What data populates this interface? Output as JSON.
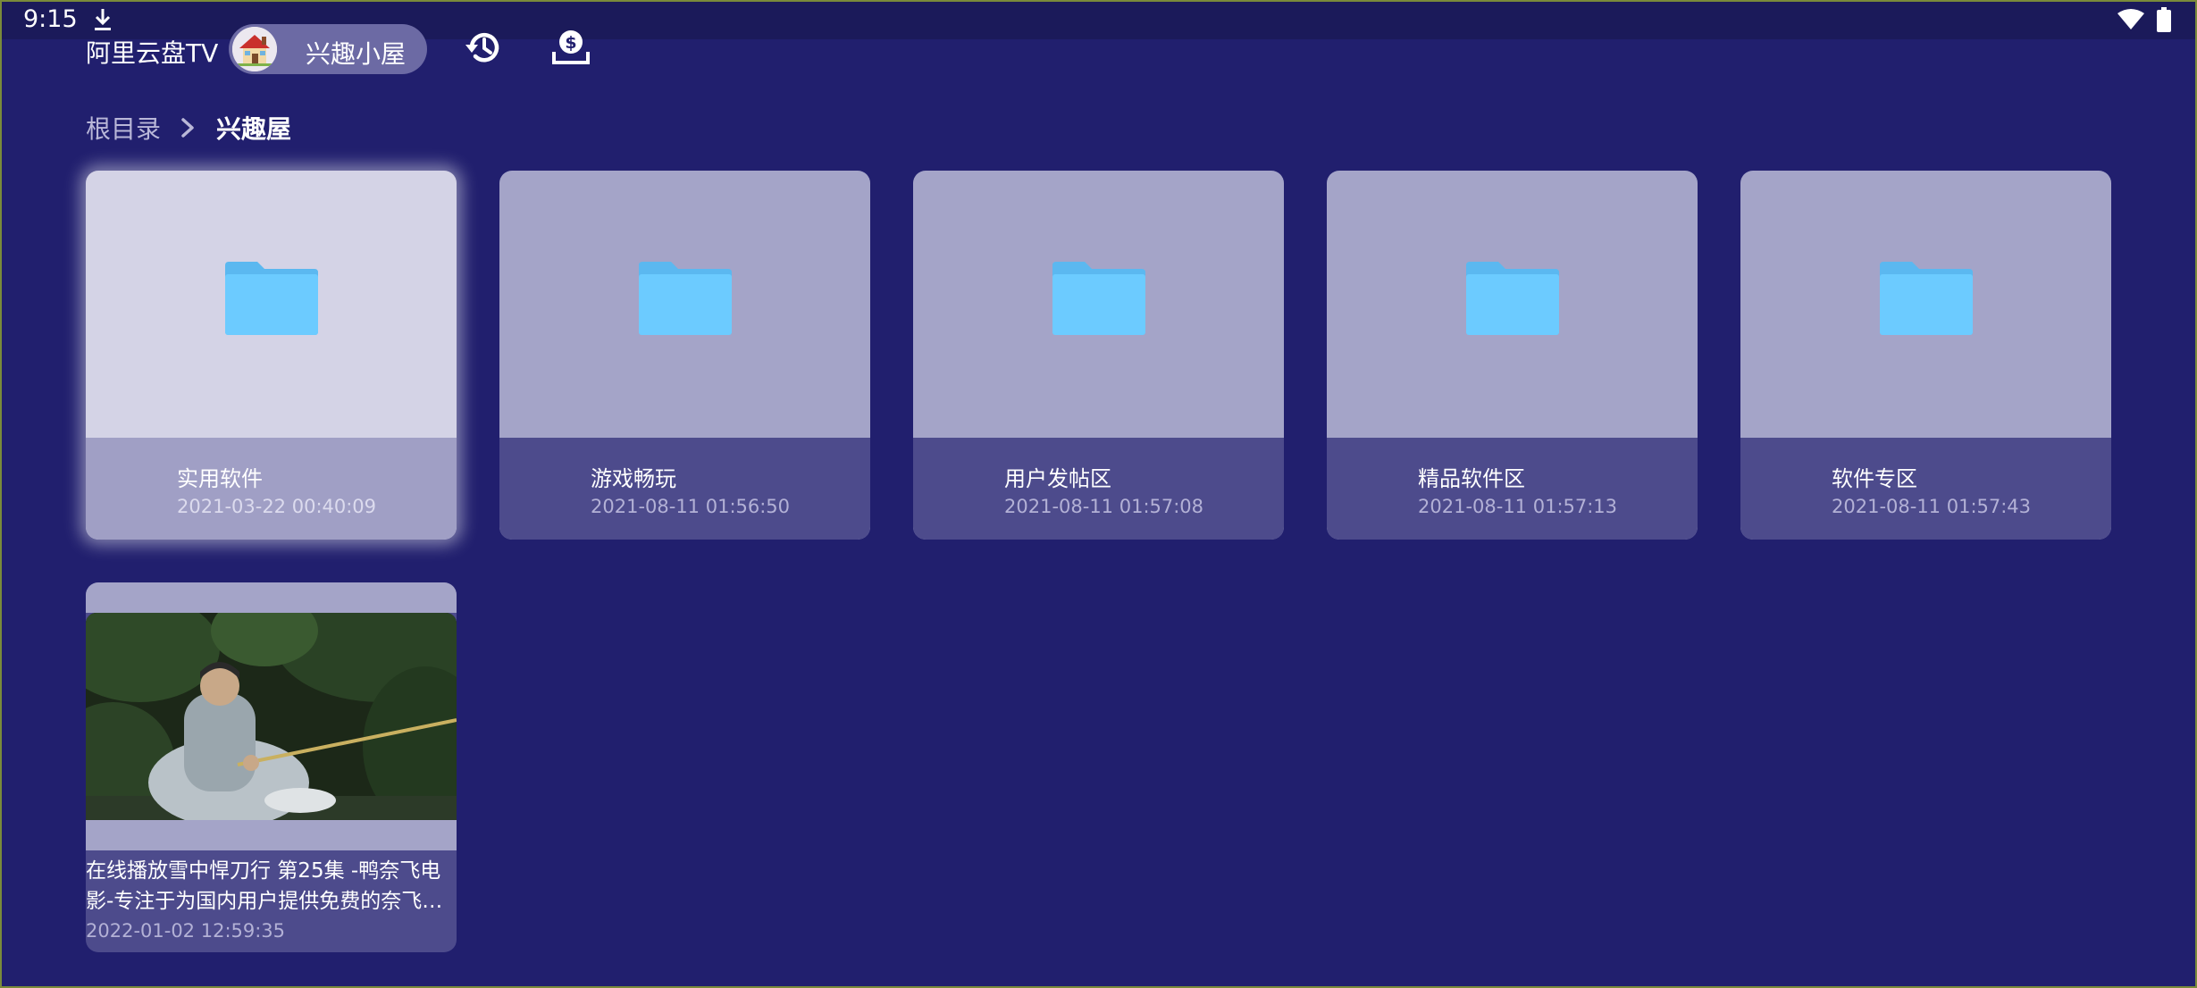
{
  "status_bar": {
    "time": "9:15",
    "icons": [
      "download-icon",
      "wifi-icon",
      "battery-icon"
    ]
  },
  "header": {
    "app_title": "阿里云盘TV",
    "user_name": "兴趣小屋",
    "icons": [
      "history-icon",
      "coin-download-icon"
    ]
  },
  "breadcrumb": {
    "root": "根目录",
    "separator_icon": "chevron-right-icon",
    "current": "兴趣屋"
  },
  "folders": [
    {
      "name": "实用软件",
      "date": "2021-03-22 00:40:09",
      "focused": true
    },
    {
      "name": "游戏畅玩",
      "date": "2021-08-11 01:56:50",
      "focused": false
    },
    {
      "name": "用户发帖区",
      "date": "2021-08-11 01:57:08",
      "focused": false
    },
    {
      "name": "精品软件区",
      "date": "2021-08-11 01:57:13",
      "focused": false
    },
    {
      "name": "软件专区",
      "date": "2021-08-11 01:57:43",
      "focused": false
    }
  ],
  "video": {
    "title": "在线播放雪中悍刀行 第25集 -鸭奈飞电影-专注于为国内用户提供免费的奈飞…",
    "date": "2022-01-02 12:59:35"
  },
  "colors": {
    "background": "#211f6e",
    "card_thumb": "#a4a4c8",
    "card_info": "#4d4b8c",
    "focused_card": "#d4d3e6",
    "folder": "#6ccbff"
  }
}
